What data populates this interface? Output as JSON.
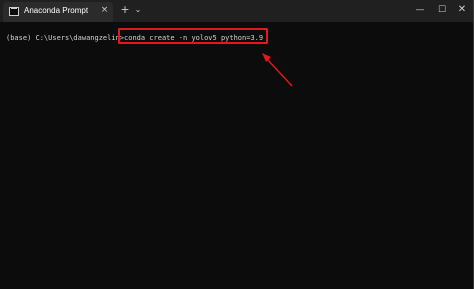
{
  "window": {
    "tab_title": "Anaconda Prompt",
    "tab_close_glyph": "×",
    "new_tab_glyph": "+",
    "dropdown_glyph": "⌄",
    "minimize_glyph": "—",
    "maximize_glyph": "☐",
    "close_glyph": "✕"
  },
  "console": {
    "prompt": "(base) C:\\Users\\dawangzelin>",
    "command": "conda create -n yolov5 python=3.9"
  },
  "colors": {
    "background": "#0c0c0c",
    "titlebar": "#202020",
    "text": "#d4d4d4",
    "annotation": "#e0191e"
  },
  "icons": [
    "terminal-icon",
    "close-icon",
    "plus-icon",
    "chevron-down-icon",
    "minimize-icon",
    "maximize-icon",
    "close-window-icon"
  ]
}
